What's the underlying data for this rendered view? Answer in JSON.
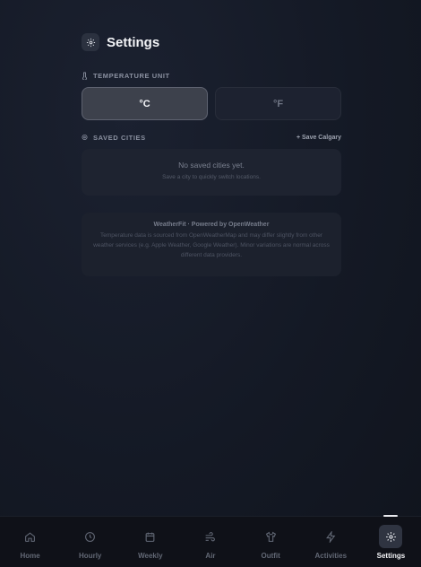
{
  "header": {
    "title": "Settings",
    "icon": "gear-icon"
  },
  "temperature": {
    "label": "TEMPERATURE UNIT",
    "icon": "thermometer-icon",
    "options": [
      "°C",
      "°F"
    ],
    "selected": "°C"
  },
  "cities": {
    "label": "SAVED CITIES",
    "icon": "location-pin-icon",
    "save_link": "+ Save Calgary",
    "empty_title": "No saved cities yet.",
    "empty_subtitle": "Save a city to quickly switch locations."
  },
  "info": {
    "title": "WeatherFit · Powered by OpenWeather",
    "body": "Temperature data is sourced from OpenWeatherMap and may differ slightly from other weather services (e.g. Apple Weather, Google Weather). Minor variations are normal across different data providers."
  },
  "tabs": [
    {
      "label": "Home",
      "icon": "home-icon"
    },
    {
      "label": "Hourly",
      "icon": "clock-icon"
    },
    {
      "label": "Weekly",
      "icon": "calendar-icon"
    },
    {
      "label": "Air",
      "icon": "wind-icon"
    },
    {
      "label": "Outfit",
      "icon": "shirt-icon"
    },
    {
      "label": "Activities",
      "icon": "lightning-icon"
    },
    {
      "label": "Settings",
      "icon": "gear-icon",
      "active": true
    }
  ],
  "colors": {
    "background": "#141925",
    "active_tab": "#2f3441",
    "card": "#1e2330"
  }
}
